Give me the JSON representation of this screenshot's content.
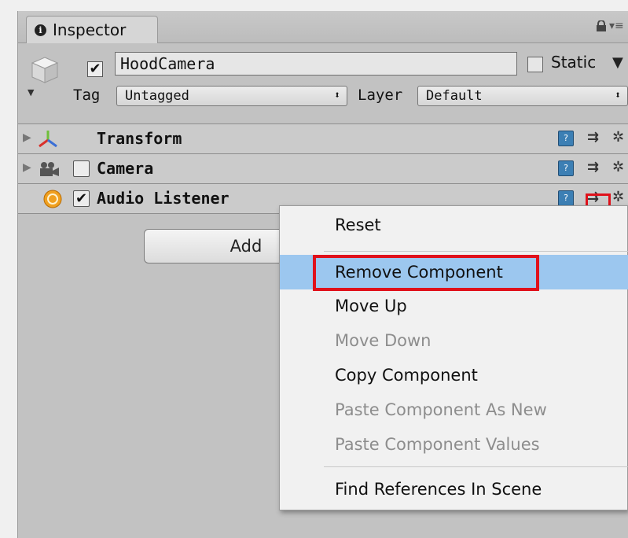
{
  "tab": {
    "title": "Inspector"
  },
  "object": {
    "name": "HoodCamera",
    "active": "✔",
    "static_label": "Static"
  },
  "tag": {
    "label": "Tag",
    "value": "Untagged"
  },
  "layer": {
    "label": "Layer",
    "value": "Default"
  },
  "components": [
    {
      "name": "Transform",
      "enabled": ""
    },
    {
      "name": "Camera",
      "enabled": ""
    },
    {
      "name": "Audio Listener",
      "enabled": "✔"
    }
  ],
  "add_button": {
    "label": "Add"
  },
  "context_menu": {
    "items": [
      {
        "label": "Reset",
        "state": "enabled"
      },
      {
        "label": "Remove Component",
        "state": "highlighted"
      },
      {
        "label": "Move Up",
        "state": "enabled"
      },
      {
        "label": "Move Down",
        "state": "disabled"
      },
      {
        "label": "Copy Component",
        "state": "enabled"
      },
      {
        "label": "Paste Component As New",
        "state": "disabled"
      },
      {
        "label": "Paste Component Values",
        "state": "disabled"
      },
      {
        "label": "Find References In Scene",
        "state": "enabled"
      }
    ]
  },
  "icons": [
    "info-icon",
    "lock-icon",
    "menu-dots-icon",
    "cube-icon",
    "transform-icon",
    "camera-icon",
    "audio-listener-icon",
    "help-icon",
    "preset-icon",
    "gear-icon"
  ],
  "colors": {
    "highlight": "#9cc7ef",
    "annotation_red": "#e0111b"
  }
}
